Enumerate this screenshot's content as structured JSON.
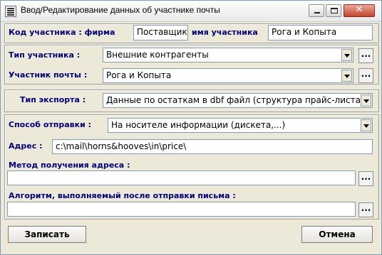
{
  "window": {
    "title": "Ввод/Редактирование данных об участнике почты"
  },
  "participant": {
    "code_label": "Код участника : фирма",
    "firm_value": "Поставщик",
    "name_label": "имя участника",
    "name_value": "Рога и Копыта"
  },
  "type": {
    "label": "Тип участника :",
    "value": "Внешние контрагенты"
  },
  "mail_participant": {
    "label": "Участник почты :",
    "value": "Рога и Копыта"
  },
  "export": {
    "label": "Тип экспорта :",
    "value": "Данные по остаткам в dbf файл (структура прайс-листа)"
  },
  "delivery": {
    "label": "Способ отправки :",
    "value": "На носителе информации (дискета,...)"
  },
  "address": {
    "label": "Адрес :",
    "value": "c:\\mail\\horns&hooves\\in\\price\\"
  },
  "address_method": {
    "label": "Метод получения адреса :",
    "value": ""
  },
  "after_send": {
    "label": "Алгоритм, выполняемый после отправки письма :",
    "value": ""
  },
  "dots_label": "...",
  "buttons": {
    "save": "Записать",
    "cancel": "Отмена"
  },
  "icons": {
    "app": "document-list-icon",
    "minimize": "minimize-icon",
    "maximize": "maximize-icon",
    "close": "close-icon",
    "dropdown": "chevron-down-icon"
  }
}
